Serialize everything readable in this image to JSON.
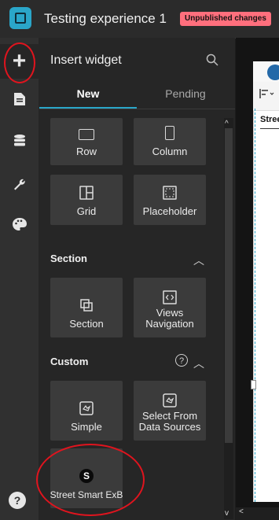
{
  "header": {
    "title": "Testing experience 1",
    "badge": "Unpublished changes"
  },
  "sidebar": {
    "items": [
      {
        "name": "insert-widget",
        "icon": "plus-icon",
        "glyph": "+"
      },
      {
        "name": "page",
        "icon": "page-icon",
        "glyph": "▤"
      },
      {
        "name": "data",
        "icon": "database-icon",
        "glyph": "≡"
      },
      {
        "name": "settings",
        "icon": "wrench-icon",
        "glyph": "🔧"
      },
      {
        "name": "theme",
        "icon": "palette-icon",
        "glyph": "🎨"
      }
    ],
    "help": "?"
  },
  "panel": {
    "title": "Insert widget",
    "tabs": {
      "new": "New",
      "pending": "Pending"
    },
    "layout_tiles": [
      {
        "label": "Row"
      },
      {
        "label": "Column"
      },
      {
        "label": "Grid"
      },
      {
        "label": "Placeholder"
      }
    ],
    "section_group": {
      "title": "Section",
      "tiles": [
        {
          "label": "Section"
        },
        {
          "label": "Views Navigation"
        }
      ]
    },
    "custom_group": {
      "title": "Custom",
      "tiles": [
        {
          "label": "Simple"
        },
        {
          "label": "Select From Data Sources"
        },
        {
          "label": "Street Smart ExB"
        }
      ]
    }
  },
  "canvas": {
    "widget_label": "Stree"
  },
  "colors": {
    "accent": "#2aa6c9",
    "badge": "#ff6f7d",
    "annotation": "#e0141e"
  }
}
